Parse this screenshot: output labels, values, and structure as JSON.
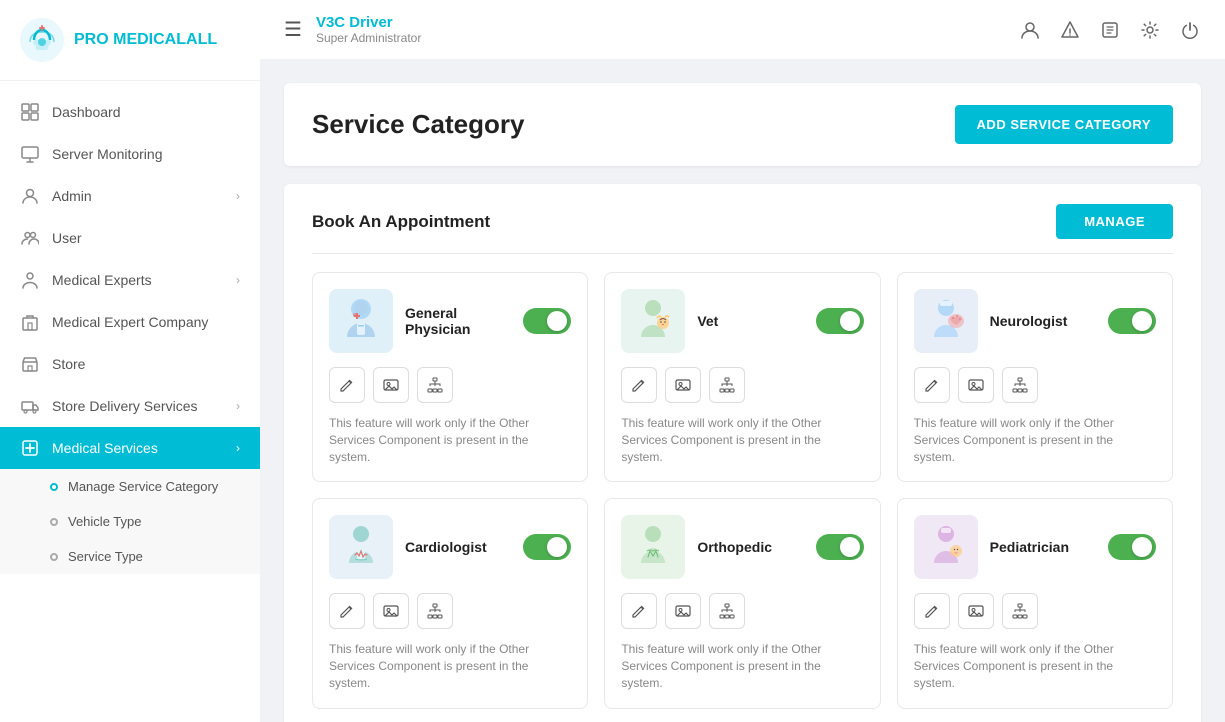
{
  "sidebar": {
    "logo": {
      "text_pre": "PRO ",
      "text_accent": "MEDICALALL"
    },
    "nav_items": [
      {
        "id": "dashboard",
        "label": "Dashboard",
        "icon": "grid",
        "active": false,
        "hasChevron": false
      },
      {
        "id": "server-monitoring",
        "label": "Server Monitoring",
        "icon": "monitor",
        "active": false,
        "hasChevron": false
      },
      {
        "id": "admin",
        "label": "Admin",
        "icon": "person",
        "active": false,
        "hasChevron": true
      },
      {
        "id": "user",
        "label": "User",
        "icon": "people",
        "active": false,
        "hasChevron": false
      },
      {
        "id": "medical-experts",
        "label": "Medical Experts",
        "icon": "person-outline",
        "active": false,
        "hasChevron": true
      },
      {
        "id": "medical-expert-company",
        "label": "Medical Expert Company",
        "icon": "building",
        "active": false,
        "hasChevron": false
      },
      {
        "id": "store",
        "label": "Store",
        "icon": "store",
        "active": false,
        "hasChevron": false
      },
      {
        "id": "store-delivery",
        "label": "Store Delivery Services",
        "icon": "delivery",
        "active": false,
        "hasChevron": true
      },
      {
        "id": "medical-services",
        "label": "Medical Services",
        "icon": "medical",
        "active": true,
        "hasChevron": true
      }
    ],
    "sub_items": [
      {
        "id": "manage-service-category",
        "label": "Manage Service Category",
        "active": true
      },
      {
        "id": "vehicle-type",
        "label": "Vehicle Type",
        "active": false
      },
      {
        "id": "service-type",
        "label": "Service Type",
        "active": false
      }
    ]
  },
  "header": {
    "title": "V3C Driver",
    "subtitle": "Super Administrator",
    "hamburger_label": "☰",
    "icons": [
      "person",
      "warning",
      "edit",
      "settings",
      "power"
    ]
  },
  "page": {
    "title": "Service Category",
    "add_button": "ADD SERVICE CATEGORY"
  },
  "section": {
    "title": "Book An Appointment",
    "manage_button": "MANAGE",
    "notice": "This feature will work only if the Other Services Component is present in the system.",
    "cards": [
      {
        "id": "general-physician",
        "name": "General Physician",
        "toggle": true,
        "avatar_color": "#e0f0f8"
      },
      {
        "id": "vet",
        "name": "Vet",
        "toggle": true,
        "avatar_color": "#e8f4f0"
      },
      {
        "id": "neurologist",
        "name": "Neurologist",
        "toggle": true,
        "avatar_color": "#e8eef8"
      },
      {
        "id": "cardiologist",
        "name": "Cardiologist",
        "toggle": true,
        "avatar_color": "#e8f0f8"
      },
      {
        "id": "orthopedic",
        "name": "Orthopedic",
        "toggle": true,
        "avatar_color": "#e8f4e8"
      },
      {
        "id": "pediatrician",
        "name": "Pediatrician",
        "toggle": true,
        "avatar_color": "#f0e8f4"
      }
    ],
    "action_icons": [
      "edit",
      "image",
      "hierarchy"
    ]
  }
}
